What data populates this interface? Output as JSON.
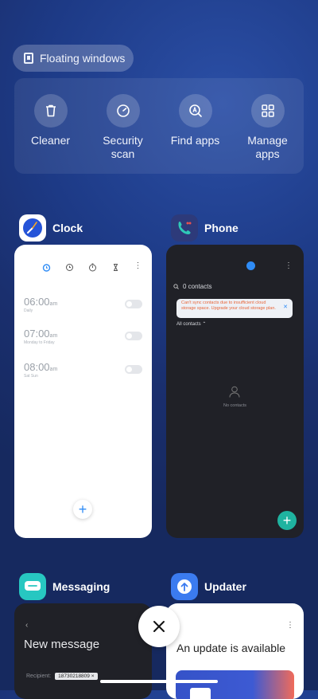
{
  "floating_windows": {
    "label": "Floating windows"
  },
  "tools": [
    {
      "label": "Cleaner",
      "icon": "trash-icon"
    },
    {
      "label": "Security\nscan",
      "icon": "shield-scan-icon"
    },
    {
      "label": "Find apps",
      "icon": "find-apps-icon"
    },
    {
      "label": "Manage\napps",
      "icon": "grid-icon"
    }
  ],
  "recent_apps": {
    "clock": {
      "name": "Clock",
      "alarms": [
        {
          "time": "06:00",
          "ampm": "am",
          "days": "Daily"
        },
        {
          "time": "07:00",
          "ampm": "am",
          "days": "Monday to Friday"
        },
        {
          "time": "08:00",
          "ampm": "am",
          "days": "Sat Sun"
        }
      ]
    },
    "phone": {
      "name": "Phone",
      "search": "0 contacts",
      "warning": "Can't sync contacts due to insufficient cloud storage space. Upgrade your cloud storage plan.",
      "filter": "All contacts",
      "empty": "No contacts"
    },
    "messaging": {
      "name": "Messaging",
      "title": "New message",
      "recipient_label": "Recipient:",
      "recipient_value": "18730218809"
    },
    "updater": {
      "name": "Updater",
      "title": "An update is available"
    }
  },
  "colors": {
    "accent": "#2f8cf6",
    "phone_fab": "#1fb3a0",
    "warning": "#e8663a"
  }
}
